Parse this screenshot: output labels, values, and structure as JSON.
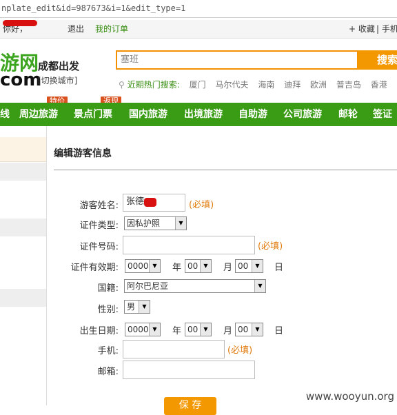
{
  "url": "nplate_edit&id=987673&i=1&edit_type=1",
  "topbar": {
    "greeting": "你好，",
    "logout": "退出",
    "my_orders": "我的订单",
    "favorites": "+ 收藏",
    "mobile": "| 手机"
  },
  "header": {
    "logo_cn": "游网",
    "logo_com": "com",
    "departure": "成都出发",
    "switch_city": "[切换城市]",
    "search": {
      "value": "塞班",
      "button": "搜索"
    },
    "hot_label": "近期热门搜索:",
    "hot_cities": [
      "厦门",
      "马尔代夫",
      "海南",
      "迪拜",
      "欧洲",
      "普吉岛",
      "香港"
    ]
  },
  "nav": {
    "items": [
      "线",
      "周边旅游",
      "景点门票",
      "国内旅游",
      "出境旅游",
      "自助游",
      "公司旅游",
      "邮轮",
      "签证"
    ],
    "badges": {
      "special": "特价",
      "refund": "返现"
    }
  },
  "form": {
    "title": "编辑游客信息",
    "fields": {
      "name": {
        "label": "游客姓名:",
        "value": "张德",
        "required": "(必填)"
      },
      "id_type": {
        "label": "证件类型:",
        "value": "因私护照"
      },
      "id_number": {
        "label": "证件号码:",
        "value": "",
        "required": "(必填)"
      },
      "validity": {
        "label": "证件有效期:",
        "year": "0000",
        "year_unit": "年",
        "month": "00",
        "month_unit": "月",
        "day": "00",
        "day_unit": "日"
      },
      "nationality": {
        "label": "国籍:",
        "value": "阿尔巴尼亚"
      },
      "gender": {
        "label": "性别:",
        "value": "男"
      },
      "birthday": {
        "label": "出生日期:",
        "year": "0000",
        "year_unit": "年",
        "month": "00",
        "month_unit": "月",
        "day": "00",
        "day_unit": "日"
      },
      "mobile": {
        "label": "手机:",
        "value": "",
        "required": "(必填)"
      },
      "email": {
        "label": "邮箱:",
        "value": ""
      }
    },
    "save": "保 存"
  },
  "watermark": "www.wooyun.org",
  "colors": {
    "brand_green": "#3a9c15",
    "accent_orange": "#f39800",
    "required": "#e07b0b",
    "redaction": "#d81010"
  }
}
